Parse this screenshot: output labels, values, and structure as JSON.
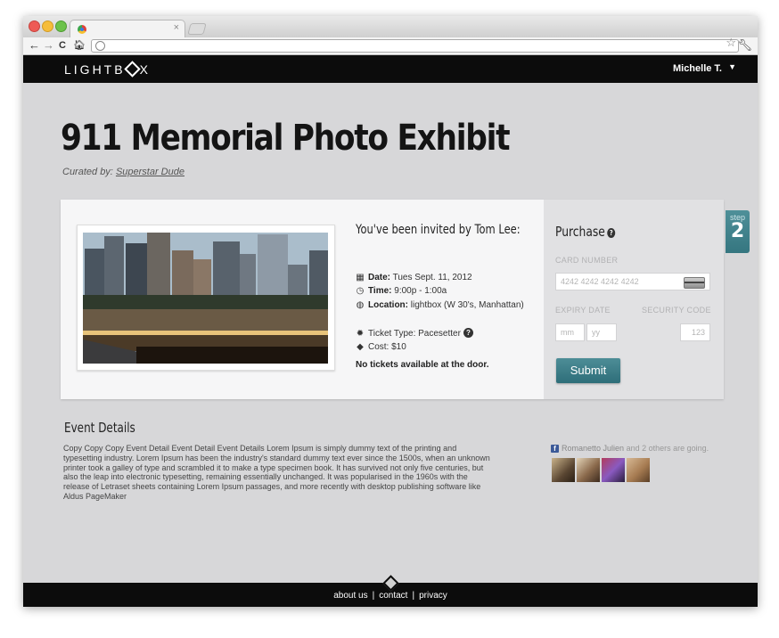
{
  "browser": {
    "tab_close": "×",
    "nav_icons": {
      "back": "←",
      "forward": "→",
      "reload": "C",
      "home": "🏠︎"
    }
  },
  "header": {
    "logo": {
      "before": "LIGHTB",
      "after": "X"
    },
    "user": "Michelle T.",
    "caret": "▼"
  },
  "page": {
    "title": "911 Memorial Photo Exhibit",
    "curated_label": "Curated by:",
    "curator": "Superstar Dude"
  },
  "invite": {
    "heading": "You've been invited by Tom Lee:",
    "date_label": "Date:",
    "date_value": "Tues Sept. 11, 2012",
    "time_label": "Time:",
    "time_value": "9:00p - 1:00a",
    "location_label": "Location:",
    "location_value": "lightbox (W 30's, Manhattan)",
    "ticket_type": "Ticket Type: Pacesetter",
    "cost": "Cost: $10",
    "help": "?",
    "no_tickets": "No tickets available at the door."
  },
  "purchase": {
    "heading": "Purchase",
    "help": "?",
    "card_label": "CARD NUMBER",
    "card_placeholder": "4242 4242 4242 4242",
    "expiry_label": "EXPIRY DATE",
    "security_label": "SECURITY CODE",
    "mm_placeholder": "mm",
    "yy_placeholder": "yy",
    "cvc_placeholder": "123",
    "submit": "Submit"
  },
  "step": {
    "label": "step",
    "number": "2"
  },
  "event": {
    "heading": "Event Details",
    "body": "Copy Copy Copy Event Detail Event Detail Event Details Lorem Ipsum is simply dummy text of the printing and typesetting industry. Lorem Ipsum has been the industry's standard dummy text ever since the 1500s, when an unknown printer took a galley of type and scrambled it to make a type specimen book. It has survived not only five centuries, but also the leap into electronic typesetting, remaining essentially unchanged. It was popularised in the 1960s with the release of Letraset sheets containing Lorem Ipsum passages, and more recently with desktop publishing software like Aldus PageMaker"
  },
  "social": {
    "fb": "f",
    "friend": "Romanetto Julien",
    "rest": "and 2 others are going."
  },
  "footer": {
    "links": [
      "about us",
      "contact",
      "privacy"
    ],
    "separator": "|"
  }
}
